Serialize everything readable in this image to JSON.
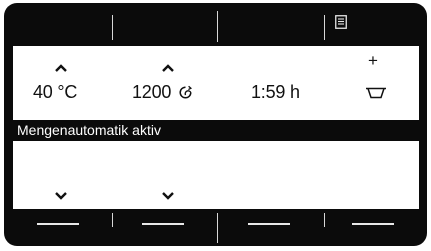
{
  "display": {
    "temperature": "40 °C",
    "spin_speed": "1200",
    "duration": "1:59 h",
    "status_message": "Mengenautomatik aktiv",
    "plus_label": "+"
  },
  "icons": {
    "menu": "menu-list-icon",
    "spin": "spin-icon",
    "detergent": "detergent-tray-icon",
    "up": "chevron-up-icon",
    "down": "chevron-down-icon"
  },
  "colors": {
    "bezel": "#0b0b0b",
    "screen": "#ffffff",
    "text": "#111111",
    "status_bar": "#0b0b0b",
    "status_text": "#ffffff"
  }
}
